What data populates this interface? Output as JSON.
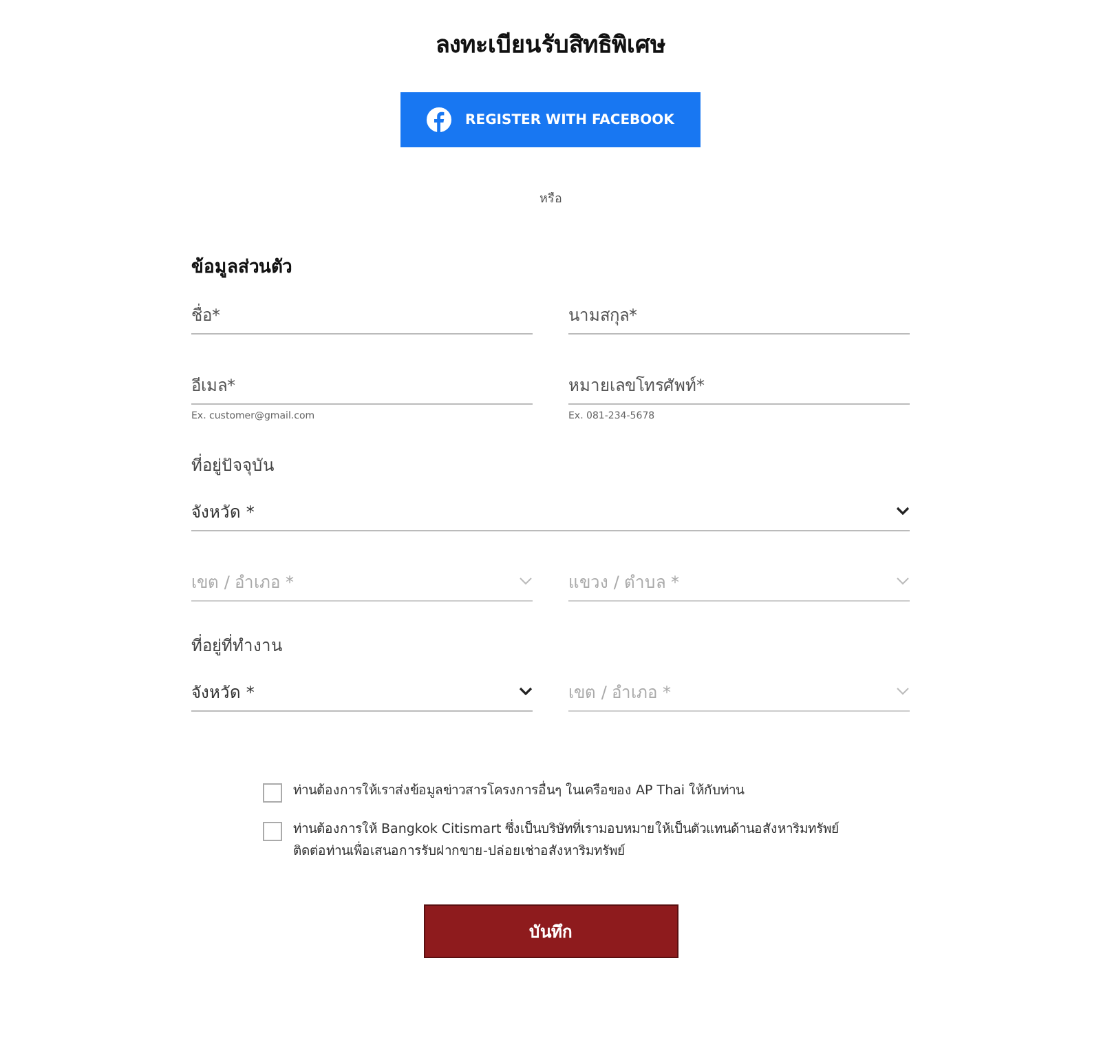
{
  "title": "ลงทะเบียนรับสิทธิพิเศษ",
  "facebook_button": {
    "label": "REGISTER WITH FACEBOOK"
  },
  "divider_text": "หรือ",
  "sections": [
    {
      "heading": "ข้อมูลส่วนตัว",
      "rows": [
        [
          {
            "kind": "text",
            "label": "ชื่อ*"
          },
          {
            "kind": "text",
            "label": "นามสกุล*"
          }
        ],
        [
          {
            "kind": "text",
            "label": "อีเมล*",
            "hint": "Ex. customer@gmail.com"
          },
          {
            "kind": "text",
            "label": "หมายเลขโทรศัพท์*",
            "hint": "Ex. 081-234-5678"
          }
        ]
      ]
    },
    {
      "heading": "ที่อยู่ปัจจุบัน",
      "rows": [
        [
          {
            "kind": "select",
            "label": "จังหวัด *",
            "disabled": false
          }
        ],
        [
          {
            "kind": "select",
            "label": "เขต / อำเภอ *",
            "disabled": true
          },
          {
            "kind": "select",
            "label": "แขวง / ตำบล *",
            "disabled": true
          }
        ]
      ]
    },
    {
      "heading": "ที่อยู่ที่ทำงาน",
      "rows": [
        [
          {
            "kind": "select",
            "label": "จังหวัด *",
            "disabled": false
          },
          {
            "kind": "select",
            "label": "เขต / อำเภอ *",
            "disabled": true
          }
        ]
      ]
    }
  ],
  "consents": [
    {
      "label": "ท่านต้องการให้เราส่งข้อมูลข่าวสารโครงการอื่นๆ ในเครือของ AP Thai ให้กับท่าน",
      "checked": false
    },
    {
      "label": "ท่านต้องการให้ Bangkok Citismart ซึ่งเป็นบริษัทที่เรามอบหมายให้เป็นตัวแทนด้านอสังหาริมทรัพย์ ติดต่อท่านเพื่อเสนอการรับฝากขาย-ปล่อยเช่าอสังหาริมทรัพย์",
      "checked": false
    }
  ],
  "submit_button": {
    "label": "บันทึก"
  }
}
